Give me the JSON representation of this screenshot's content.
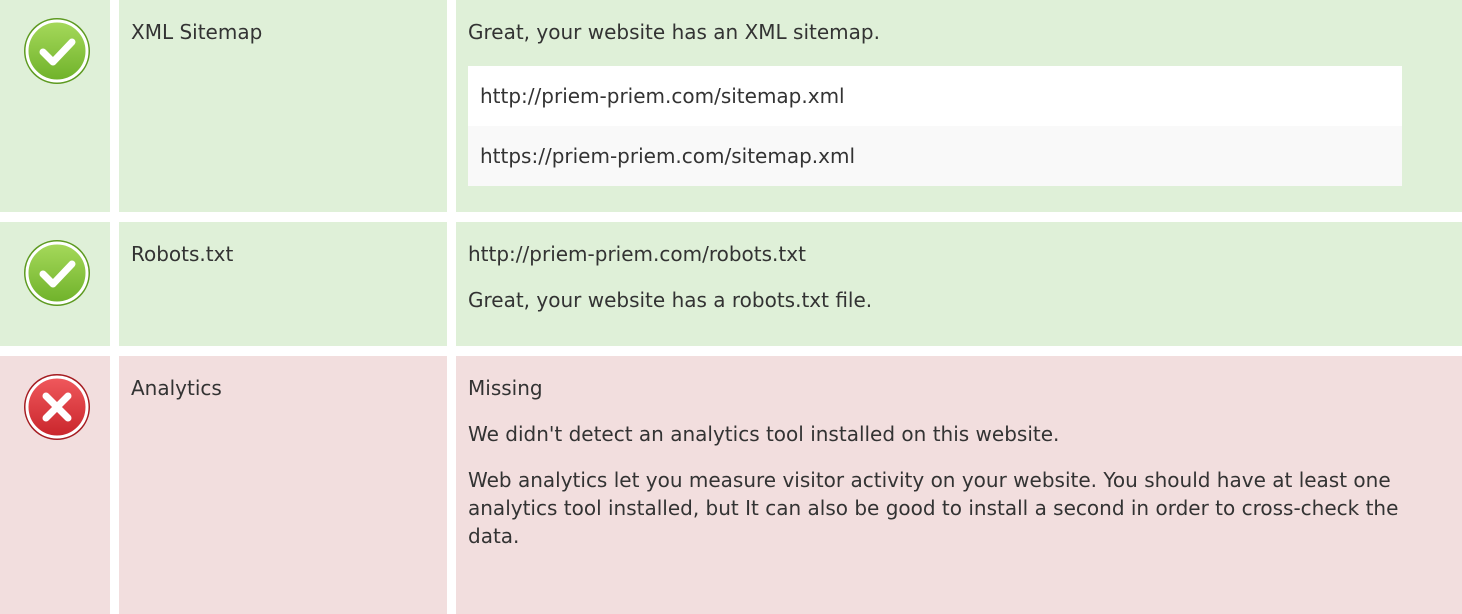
{
  "rows": [
    {
      "status": "pass",
      "icon": "check-circle-icon",
      "name": "XML Sitemap",
      "message": "Great, your website has an XML sitemap.",
      "urls": [
        "http://priem-priem.com/sitemap.xml",
        "https://priem-priem.com/sitemap.xml"
      ]
    },
    {
      "status": "pass",
      "icon": "check-circle-icon",
      "name": "Robots.txt",
      "url": "http://priem-priem.com/robots.txt",
      "message": "Great, your website has a robots.txt file."
    },
    {
      "status": "fail",
      "icon": "x-circle-icon",
      "name": "Analytics",
      "status_text": "Missing",
      "message": "We didn't detect an analytics tool installed on this website.",
      "description": "Web analytics let you measure visitor activity on your website. You should have at least one analytics tool installed, but It can also be good to install a second in order to cross-check the data."
    }
  ],
  "colors": {
    "pass_bg": "#dff0d8",
    "fail_bg": "#f2dede",
    "pass_icon": "#8cc63f",
    "fail_icon": "#e0393e"
  }
}
